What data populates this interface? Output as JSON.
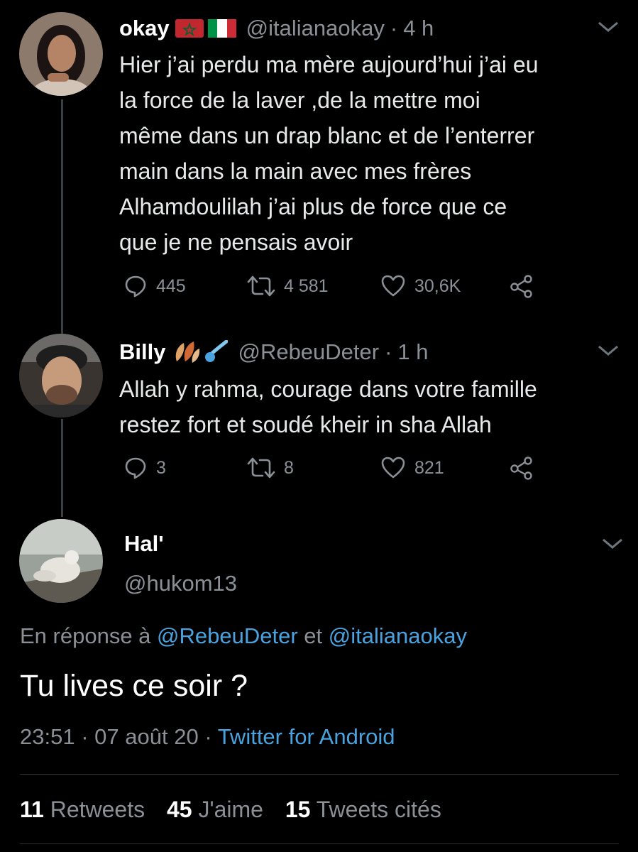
{
  "tweets": [
    {
      "name": "okay",
      "handle": "@italianaokay",
      "time": "4 h",
      "text": "Hier j’ai perdu ma mère aujourd’hui j’ai eu\nla force de la laver ,de la mettre moi\nmême dans un drap blanc et de l’enterrer\nmain dans la main avec mes frères\nAlhamdoulilah j’ai plus de force que ce\nque je ne pensais avoir",
      "replies": "445",
      "retweets": "4 581",
      "likes": "30,6K",
      "name_emojis": [
        "morocco-flag",
        "italy-flag"
      ]
    },
    {
      "name": "Billy",
      "handle": "@RebeuDeter",
      "time": "1 h",
      "text": "Allah y rahma, courage dans votre famille\nrestez fort et soudé kheir in sha Allah",
      "replies": "3",
      "retweets": "8",
      "likes": "821",
      "name_emojis": [
        "fallen-leaves",
        "comet"
      ]
    }
  ],
  "main_tweet": {
    "name": "Hal'",
    "handle": "@hukom13",
    "reply_prefix": "En réponse à",
    "reply_mention_1": "@RebeuDeter",
    "reply_and": "et",
    "reply_mention_2": "@italianaokay",
    "text": "Tu lives ce soir ?",
    "time": "23:51",
    "date": "07 août 20",
    "source": "Twitter for Android",
    "stats": {
      "retweets_count": "11",
      "retweets_label": "Retweets",
      "likes_count": "45",
      "likes_label": "J'aime",
      "quotes_count": "15",
      "quotes_label": "Tweets cités"
    }
  },
  "separator": "·",
  "colors": {
    "background": "#000000",
    "text": "#e7e9ea",
    "secondary": "#8b9096",
    "link": "#4aa3df"
  }
}
